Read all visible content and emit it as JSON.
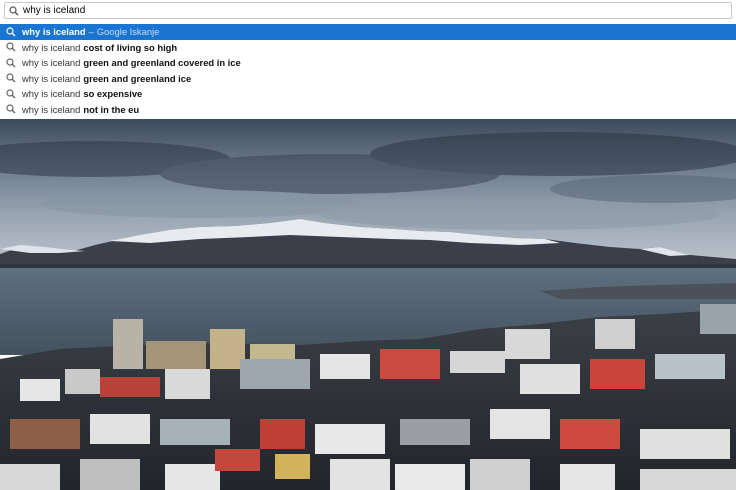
{
  "omnibox": {
    "query": "why is iceland",
    "icon": "search-icon"
  },
  "suggestions": [
    {
      "base": "why is iceland",
      "suffix": "",
      "separator": "–",
      "source": "Google Iskanje",
      "selected": true
    },
    {
      "base": "why is iceland",
      "suffix": "cost of living so high"
    },
    {
      "base": "why is iceland",
      "suffix": "green and greenland covered in ice"
    },
    {
      "base": "why is iceland",
      "suffix": "green and greenland ice"
    },
    {
      "base": "why is iceland",
      "suffix": "so expensive"
    },
    {
      "base": "why is iceland",
      "suffix": "not in the eu"
    }
  ],
  "colors": {
    "selected_row": "#1a75d2",
    "page_bg": "#ffffff"
  }
}
